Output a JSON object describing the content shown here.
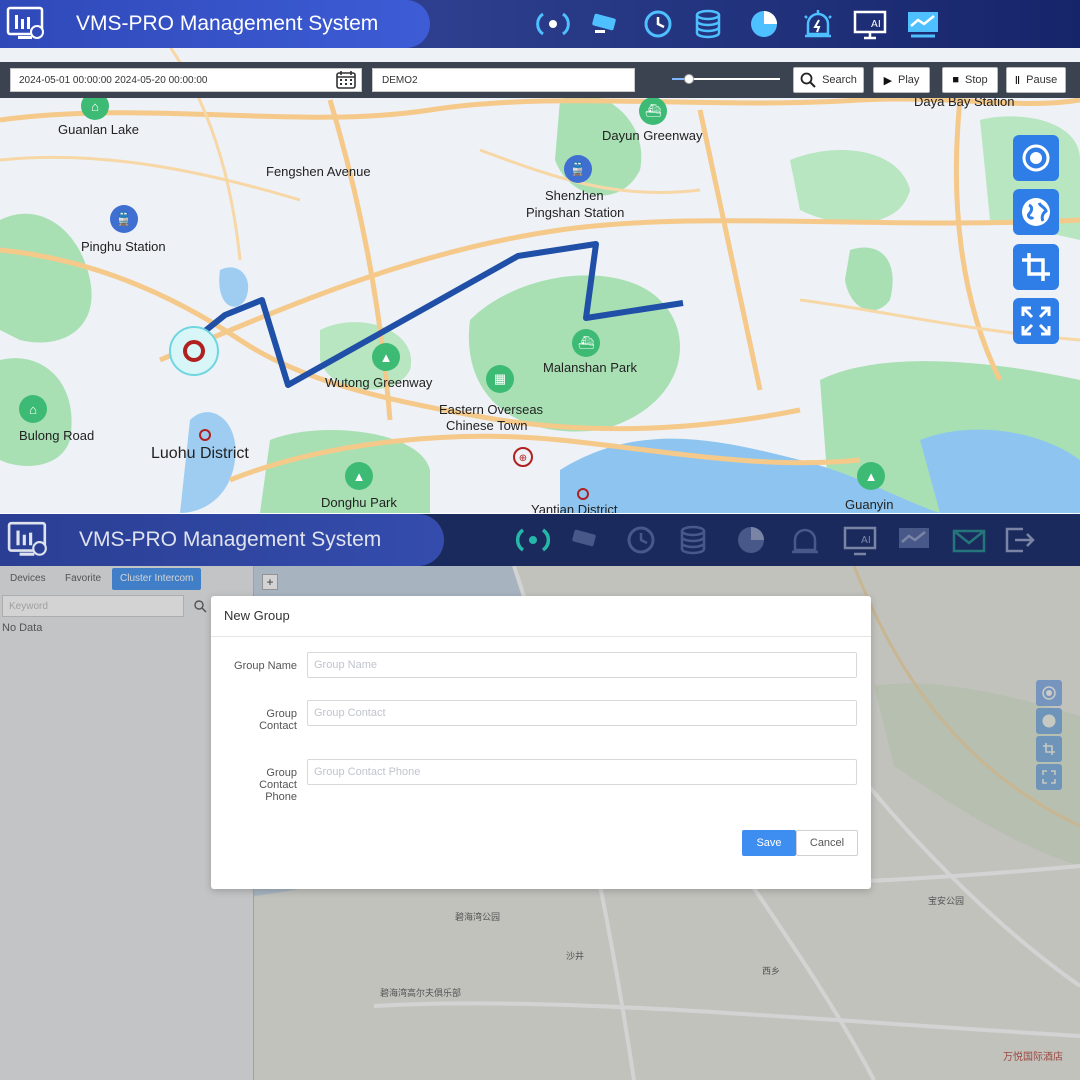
{
  "top": {
    "app_title": "VMS-PRO Management System",
    "header_icons": [
      "dispatch-icon",
      "camera-icon",
      "history-icon",
      "database-icon",
      "statistics-icon",
      "alarm-icon",
      "ai-monitor-icon",
      "trend-icon"
    ],
    "date_range": "2024-05-01  00:00:00  2024-05-20  00:00:00",
    "device": "DEMO2",
    "buttons": {
      "search": "Search",
      "play": "Play",
      "stop": "Stop",
      "pause": "Pause"
    },
    "map_controls": [
      "locate-icon",
      "globe-icon",
      "crop-icon",
      "fullscreen-icon"
    ],
    "map_labels": {
      "guanlan_lake": "Guanlan Lake",
      "dayun_greenway": "Dayun Greenway",
      "daya_bay_station": "Daya Bay Station",
      "fengshen_avenue": "Fengshen Avenue",
      "pingshan_station_1": "Shenzhen",
      "pingshan_station_2": "Pingshan Station",
      "pinghu_station": "Pinghu Station",
      "malanshan_park": "Malanshan Park",
      "wutong_greenway": "Wutong Greenway",
      "eastern_overseas_1": "Eastern Overseas",
      "eastern_overseas_2": "Chinese Town",
      "bulong_road": "Bulong Road",
      "luohu_district": "Luohu District",
      "donghu_park": "Donghu Park",
      "yantian_district": "Yantian District",
      "guanyin": "Guanyin"
    },
    "colors": {
      "route": "#1f4fa6",
      "accent": "#2f7de6",
      "header": "#2d3f8e"
    }
  },
  "bottom": {
    "app_title": "VMS-PRO Management System",
    "header_icons": [
      "dispatch-icon",
      "camera-icon",
      "history-icon",
      "database-icon",
      "statistics-icon",
      "alarm-icon",
      "ai-monitor-icon",
      "trend-icon",
      "mail-icon",
      "logout-icon"
    ],
    "tabs": {
      "devices": "Devices",
      "favorite": "Favorite",
      "cluster": "Cluster Intercom"
    },
    "keyword_placeholder": "Keyword",
    "no_data": "No Data",
    "modal": {
      "title": "New Group",
      "group_name_label": "Group Name",
      "group_name_placeholder": "Group Name",
      "group_contact_label_1": "Group",
      "group_contact_label_2": "Contact",
      "group_contact_placeholder": "Group Contact",
      "group_phone_label_1": "Group",
      "group_phone_label_2": "Contact",
      "group_phone_label_3": "Phone",
      "group_phone_placeholder": "Group Contact Phone",
      "save": "Save",
      "cancel": "Cancel"
    },
    "map_labels": {
      "bihai_park": "碧海湾公园",
      "shajing": "沙井",
      "xixiang": "西乡",
      "baoan_park": "宝安公园",
      "hotel": "万悦国际酒店",
      "club": "碧海湾高尔夫俱乐部"
    }
  }
}
